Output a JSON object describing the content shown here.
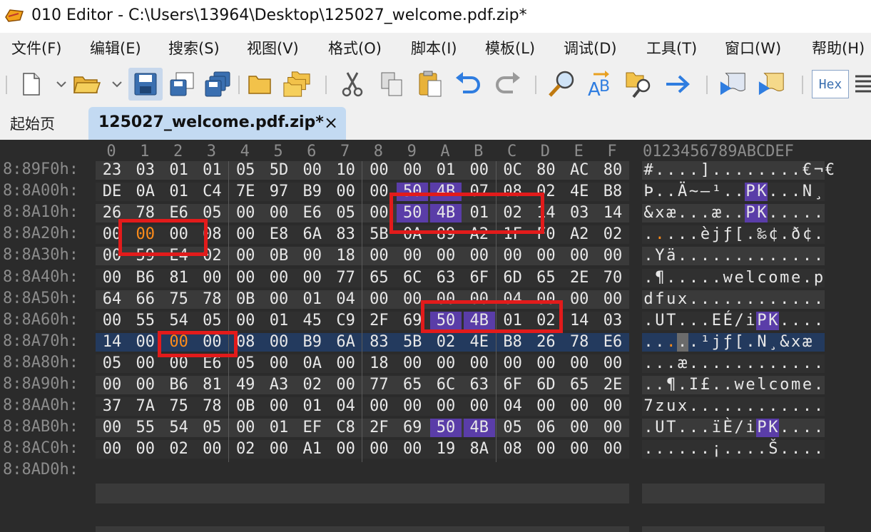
{
  "window": {
    "title": "010 Editor - C:\\Users\\13964\\Desktop\\125027_welcome.pdf.zip*"
  },
  "menu": [
    "文件(F)",
    "编辑(E)",
    "搜索(S)",
    "视图(V)",
    "格式(O)",
    "脚本(I)",
    "模板(L)",
    "调试(D)",
    "工具(T)",
    "窗口(W)",
    "帮助(H)"
  ],
  "toolbar": {
    "icons": [
      "new-file-icon",
      "open-folder-icon",
      "save-icon",
      "save-as-icon",
      "save-all-icon",
      "folder-icon",
      "open-folders-icon",
      "cut-icon",
      "copy-icon",
      "paste-icon",
      "undo-icon",
      "redo-icon",
      "find-icon",
      "replace-icon",
      "find-in-files-icon",
      "goto-icon",
      "run-script-icon",
      "run-template-icon"
    ],
    "hex_label": "Hex"
  },
  "tabs": {
    "home": "起始页",
    "file": "125027_welcome.pdf.zip*",
    "close": "×"
  },
  "hex": {
    "column_headers": [
      "0",
      "1",
      "2",
      "3",
      "4",
      "5",
      "6",
      "7",
      "8",
      "9",
      "A",
      "B",
      "C",
      "D",
      "E",
      "F"
    ],
    "ascii_header": "0123456789ABCDEF",
    "rows": [
      {
        "addr": "8:89F0h:",
        "bytes": [
          "23",
          "03",
          "01",
          "01",
          "05",
          "5D",
          "00",
          "10",
          "00",
          "00",
          "01",
          "00",
          "0C",
          "80",
          "AC",
          "80"
        ],
        "ascii": "#....]........€¬€"
      },
      {
        "addr": "8:8A00h:",
        "bytes": [
          "DE",
          "0A",
          "01",
          "C4",
          "7E",
          "97",
          "B9",
          "00",
          "00",
          "50",
          "4B",
          "07",
          "08",
          "02",
          "4E",
          "B8"
        ],
        "ascii": "Þ..Ä~—¹..PK...N¸"
      },
      {
        "addr": "8:8A10h:",
        "bytes": [
          "26",
          "78",
          "E6",
          "05",
          "00",
          "00",
          "E6",
          "05",
          "00",
          "50",
          "4B",
          "01",
          "02",
          "14",
          "03",
          "14"
        ],
        "ascii": "&xæ...æ..PK....."
      },
      {
        "addr": "8:8A20h:",
        "bytes": [
          "00",
          "00",
          "00",
          "08",
          "00",
          "E8",
          "6A",
          "83",
          "5B",
          "0A",
          "89",
          "A2",
          "1F",
          "F0",
          "A2",
          "02"
        ],
        "ascii": ".....èjƒ[.‰¢.ð¢."
      },
      {
        "addr": "8:8A30h:",
        "bytes": [
          "00",
          "59",
          "E4",
          "02",
          "00",
          "0B",
          "00",
          "18",
          "00",
          "00",
          "00",
          "00",
          "00",
          "00",
          "00",
          "00"
        ],
        "ascii": ".Yä............."
      },
      {
        "addr": "8:8A40h:",
        "bytes": [
          "00",
          "B6",
          "81",
          "00",
          "00",
          "00",
          "00",
          "77",
          "65",
          "6C",
          "63",
          "6F",
          "6D",
          "65",
          "2E",
          "70"
        ],
        "ascii": ".¶.....welcome.p"
      },
      {
        "addr": "8:8A50h:",
        "bytes": [
          "64",
          "66",
          "75",
          "78",
          "0B",
          "00",
          "01",
          "04",
          "00",
          "00",
          "00",
          "00",
          "04",
          "00",
          "00",
          "00"
        ],
        "ascii": "dfux............"
      },
      {
        "addr": "8:8A60h:",
        "bytes": [
          "00",
          "55",
          "54",
          "05",
          "00",
          "01",
          "45",
          "C9",
          "2F",
          "69",
          "50",
          "4B",
          "01",
          "02",
          "14",
          "03"
        ],
        "ascii": ".UT...EÉ/iPK...."
      },
      {
        "addr": "8:8A70h:",
        "bytes": [
          "14",
          "00",
          "00",
          "00",
          "08",
          "00",
          "B9",
          "6A",
          "83",
          "5B",
          "02",
          "4E",
          "B8",
          "26",
          "78",
          "E6"
        ],
        "ascii": ".....¹jƒ[.N¸&xæ"
      },
      {
        "addr": "8:8A80h:",
        "bytes": [
          "05",
          "00",
          "00",
          "E6",
          "05",
          "00",
          "0A",
          "00",
          "18",
          "00",
          "00",
          "00",
          "00",
          "00",
          "00",
          "00"
        ],
        "ascii": "...æ............"
      },
      {
        "addr": "8:8A90h:",
        "bytes": [
          "00",
          "00",
          "B6",
          "81",
          "49",
          "A3",
          "02",
          "00",
          "77",
          "65",
          "6C",
          "63",
          "6F",
          "6D",
          "65",
          "2E"
        ],
        "ascii": "..¶.I£..welcome."
      },
      {
        "addr": "8:8AA0h:",
        "bytes": [
          "37",
          "7A",
          "75",
          "78",
          "0B",
          "00",
          "01",
          "04",
          "00",
          "00",
          "00",
          "00",
          "04",
          "00",
          "00",
          "00"
        ],
        "ascii": "7zux............"
      },
      {
        "addr": "8:8AB0h:",
        "bytes": [
          "00",
          "55",
          "54",
          "05",
          "00",
          "01",
          "EF",
          "C8",
          "2F",
          "69",
          "50",
          "4B",
          "05",
          "06",
          "00",
          "00"
        ],
        "ascii": ".UT...ïÈ/iPK...."
      },
      {
        "addr": "8:8AC0h:",
        "bytes": [
          "00",
          "00",
          "02",
          "00",
          "02",
          "00",
          "A1",
          "00",
          "00",
          "00",
          "19",
          "8A",
          "08",
          "00",
          "00",
          "00"
        ],
        "ascii": "......¡....Š...."
      },
      {
        "addr": "8:8AD0h:",
        "bytes": [],
        "ascii": ""
      }
    ],
    "pk_cells": [
      [
        1,
        9
      ],
      [
        1,
        10
      ],
      [
        2,
        9
      ],
      [
        2,
        10
      ],
      [
        7,
        10
      ],
      [
        7,
        11
      ],
      [
        12,
        10
      ],
      [
        12,
        11
      ]
    ],
    "modified_cells": [
      [
        3,
        1
      ],
      [
        8,
        2
      ]
    ],
    "selected_row": 8
  },
  "colors": {
    "pk_highlight": "#5a3da8",
    "modified": "#ff8c1a",
    "annotation_box": "#e21b1b",
    "selected_row": "#233a5e"
  }
}
